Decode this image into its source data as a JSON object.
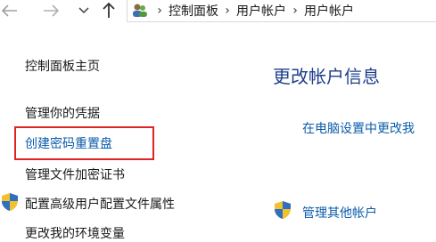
{
  "breadcrumb": [
    "控制面板",
    "用户帐户",
    "用户帐户"
  ],
  "sidebar": {
    "items": [
      {
        "label": "控制面板主页"
      },
      {
        "label": "管理你的凭据"
      },
      {
        "label": "创建密码重置盘"
      },
      {
        "label": "管理文件加密证书"
      },
      {
        "label": "配置高级用户配置文件属性"
      },
      {
        "label": "更改我的环境变量"
      }
    ]
  },
  "main": {
    "title": "更改帐户信息",
    "pc_settings_link": "在电脑设置中更改我",
    "manage_other_link": "管理其他帐户"
  },
  "colors": {
    "accent_red": "#e02424",
    "link_blue": "#0b5cab",
    "title_blue": "#1e3f8b"
  },
  "icons": [
    "back-arrow-icon",
    "forward-arrow-icon",
    "recent-dropdown-icon",
    "up-arrow-icon",
    "users-folder-icon",
    "uac-shield-icon"
  ]
}
